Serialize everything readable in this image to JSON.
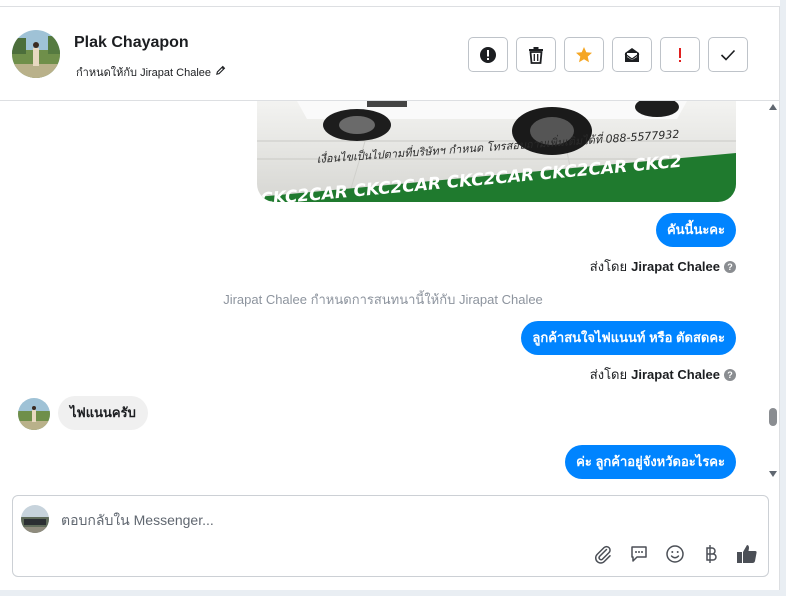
{
  "header": {
    "name": "Plak Chayapon",
    "assigned_to": "กำหนดให้กับ Jirapat Chalee",
    "actions": [
      {
        "icon": "alert-circle-icon",
        "label": "mark-spam"
      },
      {
        "icon": "trash-icon",
        "label": "delete"
      },
      {
        "icon": "star-icon",
        "label": "star"
      },
      {
        "icon": "mail-icon",
        "label": "mark-unread"
      },
      {
        "icon": "exclamation-icon",
        "label": "follow-up"
      },
      {
        "icon": "check-icon",
        "label": "done"
      }
    ]
  },
  "messages": {
    "image_caption": "เงื่อนไขเป็นไปตามที่บริษัทฯ กำหนด โทรสอบถามเพิ่มเติมได้ที่ 088-5577932",
    "image_banner": "CKC2CAR CKC2CAR CKC2CAR CKC2CAR CKC2",
    "msg1": "คันนี้นะคะ",
    "sent_by_label_1": "ส่งโดย",
    "sent_by_name_1": "Jirapat Chalee",
    "system_note": "Jirapat Chalee กำหนดการสนทนานี้ให้กับ Jirapat Chalee",
    "msg2": "ลูกค้าสนใจไฟแนนท์ หรือ ตัดสดคะ",
    "sent_by_label_2": "ส่งโดย",
    "sent_by_name_2": "Jirapat Chalee",
    "msg3_incoming": "ไฟแนนครับ",
    "msg4": "ค่ะ ลูกค้าอยู่จังหวัดอะไรคะ"
  },
  "composer": {
    "placeholder": "ตอบกลับใน Messenger...",
    "tools": [
      "attach-icon",
      "chat-icon",
      "emoji-icon",
      "baht-icon",
      "like-icon"
    ]
  },
  "colors": {
    "accent": "#0084ff",
    "star": "#f5a623",
    "exclamation": "#e02020"
  }
}
